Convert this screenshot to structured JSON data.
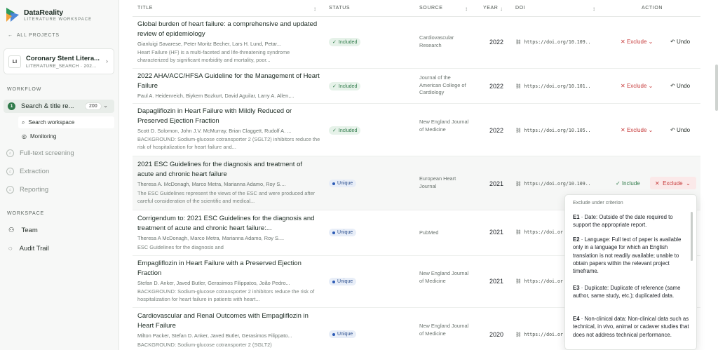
{
  "brand": {
    "name": "DataReality",
    "sub": "LITERATURE WORKSPACE"
  },
  "nav": {
    "all_projects": "ALL PROJECTS"
  },
  "project": {
    "badge": "LI",
    "name": "Coronary Stent Litera...",
    "sub": "LITERATURE_SEARCH · 202..."
  },
  "workflow": {
    "label": "WORKFLOW",
    "active": {
      "num": "1",
      "label": "Search & title re...",
      "count": "200"
    },
    "sub_items": [
      "Search workspace",
      "Monitoring"
    ],
    "items": [
      "Full-text screening",
      "Extraction",
      "Reporting"
    ]
  },
  "workspace": {
    "label": "WORKSPACE",
    "items": [
      "Team",
      "Audit Trail"
    ]
  },
  "table": {
    "headers": {
      "title": "TITLE",
      "status": "STATUS",
      "source": "SOURCE",
      "year": "YEAR",
      "doi": "DOI",
      "action": "ACTION"
    },
    "rows": [
      {
        "title": "Global burden of heart failure: a comprehensive and updated review of epidemiology",
        "authors": "Gianluigi Savarese, Peter Moritz Becher, Lars H. Lund, Petar...",
        "abstract": "Heart Failure (HF) is a multi-faceted and life-threatening syndrome characterized by significant morbidity and mortality, poor...",
        "status": "Included",
        "source": "Cardiovascular Research",
        "year": "2022",
        "doi": "https://doi.org/10.109..",
        "exclude": "Exclude",
        "undo": "Undo"
      },
      {
        "title": "2022 AHA/ACC/HFSA Guideline for the Management of Heart Failure",
        "authors": "Paul A. Heidenreich, Biykem Bozkurt, David Aguilar, Larry A. Allen,...",
        "abstract": "",
        "status": "Included",
        "source": "Journal of the American College of Cardiology",
        "year": "2022",
        "doi": "https://doi.org/10.101..",
        "exclude": "Exclude",
        "undo": "Undo"
      },
      {
        "title": "Dapagliflozin in Heart Failure with Mildly Reduced or Preserved Ejection Fraction",
        "authors": "Scott D. Solomon, John J.V. McMurray, Brian Claggett, Rudolf A. ...",
        "abstract": "BACKGROUND: Sodium-glucose cotransporter 2 (SGLT2) inhibitors reduce the risk of hospitalization for heart failure and...",
        "status": "Included",
        "source": "New England Journal of Medicine",
        "year": "2022",
        "doi": "https://doi.org/10.105..",
        "exclude": "Exclude",
        "undo": "Undo"
      },
      {
        "title": "2021 ESC Guidelines for the diagnosis and treatment of acute and chronic heart failure",
        "authors": "Theresa A. McDonagh, Marco Metra, Marianna Adamo, Roy S....",
        "abstract": "The ESC Guidelines represent the views of the ESC and were produced after careful consideration of the scientific and medical...",
        "status": "Unique",
        "source": "European Heart Journal",
        "year": "2021",
        "doi": "https://doi.org/10.109..",
        "include": "Include",
        "exclude": "Exclude"
      },
      {
        "title": "Corrigendum to: 2021 ESC Guidelines for the diagnosis and treatment of acute and chronic heart failure:...",
        "authors": "Theresa A McDonagh, Marco Metra, Marianna Adamo, Roy S....",
        "abstract": "ESC Guidelines for the diagnosis and",
        "status": "Unique",
        "source": "PubMed",
        "year": "2021",
        "doi": "https://doi.or"
      },
      {
        "title": "Empagliflozin in Heart Failure with a Preserved Ejection Fraction",
        "authors": "Stefan D. Anker, Javed Butler, Gerasimos Filippatos, João Pedro...",
        "abstract": "BACKGROUND: Sodium-glucose cotransporter 2 inhibitors reduce the risk of hospitalization for heart failure in patients with heart...",
        "status": "Unique",
        "source": "New England Journal of Medicine",
        "year": "2021",
        "doi": "https://doi.or"
      },
      {
        "title": "Cardiovascular and Renal Outcomes with Empagliflozin in Heart Failure",
        "authors": "Milton Packer, Stefan D. Anker, Javed Butler, Gerasimos Filippato...",
        "abstract": "BACKGROUND: Sodium-glucose cotransporter 2 (SGLT2)",
        "status": "Unique",
        "source": "New England Journal of Medicine",
        "year": "2020",
        "doi": "https://doi.or"
      }
    ]
  },
  "dropdown": {
    "header": "Exclude under criterion",
    "criteria": [
      {
        "code": "E1",
        "text": "Date: Outside of the date required to support the appropriate report."
      },
      {
        "code": "E2",
        "text": "Language: Full text of paper is available only in a language for which an English translation is not readily available; unable to obtain papers within the relevant project timeframe."
      },
      {
        "code": "E3",
        "text": "Duplicate: Duplicate of reference (same author, same study, etc.); duplicated data."
      },
      {
        "code": "E4",
        "text": "Non-clinical data: Non-clinical data such as technical, in vivo, animal or cadaver studies that does not address technical performance."
      }
    ]
  },
  "colors": {
    "accent": "#2f7a4a",
    "danger": "#c63b3b",
    "unique": "#2c4f8e"
  }
}
